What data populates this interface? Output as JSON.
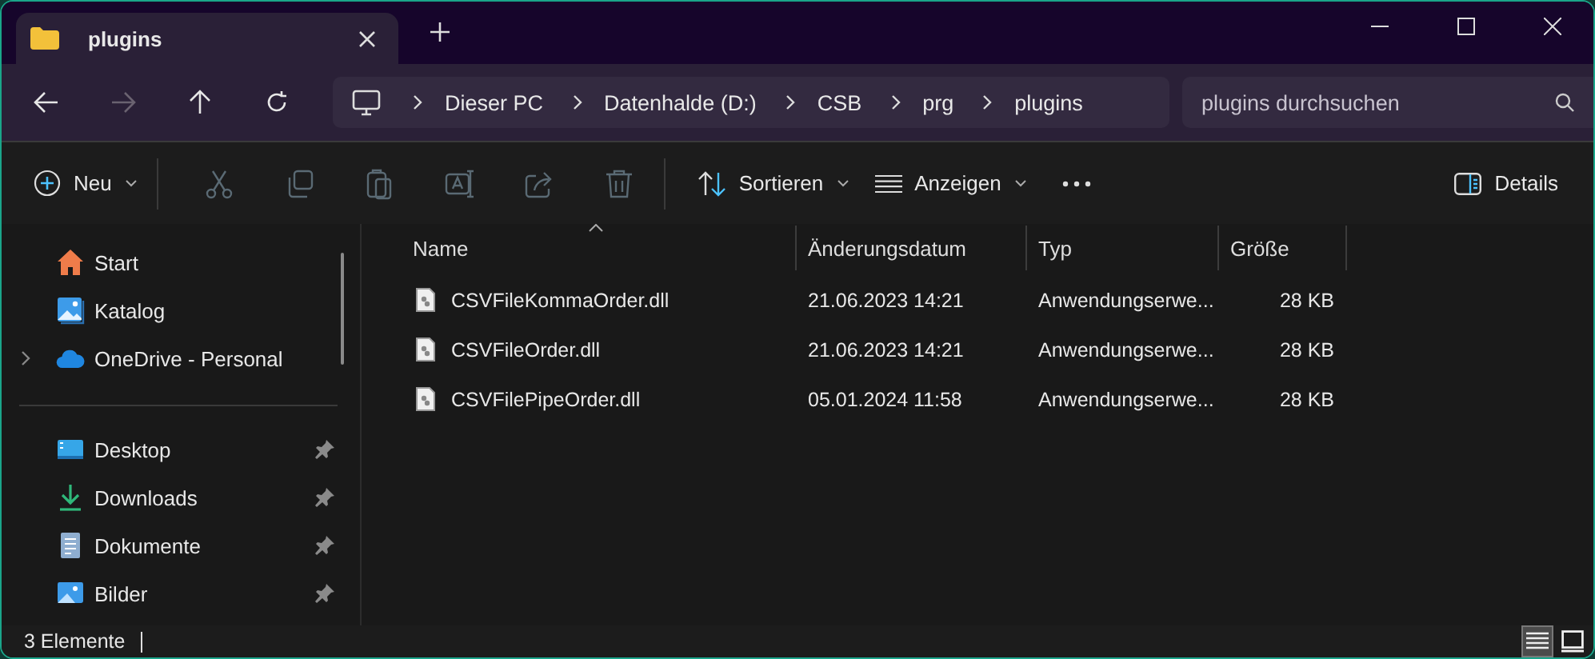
{
  "tab": {
    "title": "plugins",
    "selected": true
  },
  "window_controls": [
    {
      "kind": "minimize"
    },
    {
      "kind": "maximize"
    },
    {
      "kind": "close"
    }
  ],
  "nav_buttons": [
    {
      "kind": "back",
      "disabled": false
    },
    {
      "kind": "forward",
      "disabled": true
    },
    {
      "kind": "up",
      "disabled": false
    },
    {
      "kind": "refresh",
      "disabled": false
    }
  ],
  "breadcrumb": [
    "Dieser PC",
    "Datenhalde (D:)",
    "CSB",
    "prg",
    "plugins"
  ],
  "search": {
    "placeholder": "plugins durchsuchen"
  },
  "toolbar": {
    "new": {
      "label": "Neu"
    },
    "actions": [
      {
        "kind": "cut",
        "disabled": true
      },
      {
        "kind": "copy",
        "disabled": true
      },
      {
        "kind": "paste",
        "disabled": true
      },
      {
        "kind": "rename",
        "disabled": true
      },
      {
        "kind": "share",
        "disabled": true
      },
      {
        "kind": "delete",
        "disabled": true
      }
    ],
    "sort": {
      "label": "Sortieren"
    },
    "view": {
      "label": "Anzeigen"
    },
    "details": {
      "label": "Details"
    }
  },
  "sidebar": {
    "groups": [
      [
        {
          "kind": "home",
          "label": "Start",
          "expandable": false,
          "pinned": false
        },
        {
          "kind": "gallery",
          "label": "Katalog",
          "expandable": false,
          "pinned": false
        },
        {
          "kind": "cloud",
          "label": "OneDrive - Personal",
          "expandable": true,
          "pinned": false
        }
      ],
      [
        {
          "kind": "desktop",
          "label": "Desktop",
          "expandable": false,
          "pinned": true
        },
        {
          "kind": "download",
          "label": "Downloads",
          "expandable": false,
          "pinned": true
        },
        {
          "kind": "document",
          "label": "Dokumente",
          "expandable": false,
          "pinned": true
        },
        {
          "kind": "pictures",
          "label": "Bilder",
          "expandable": false,
          "pinned": true
        }
      ]
    ]
  },
  "table": {
    "columns": [
      {
        "label": "Name",
        "sorted": true
      },
      {
        "label": "Änderungsdatum",
        "sorted": false
      },
      {
        "label": "Typ",
        "sorted": false
      },
      {
        "label": "Größe",
        "sorted": false
      }
    ],
    "rows": [
      {
        "name": "CSVFileKommaOrder.dll",
        "date": "21.06.2023 14:21",
        "type": "Anwendungserwe...",
        "size": "28 KB",
        "selected": false
      },
      {
        "name": "CSVFileOrder.dll",
        "date": "21.06.2023 14:21",
        "type": "Anwendungserwe...",
        "size": "28 KB",
        "selected": false
      },
      {
        "name": "CSVFilePipeOrder.dll",
        "date": "05.01.2024 11:58",
        "type": "Anwendungserwe...",
        "size": "28 KB",
        "selected": false
      }
    ]
  },
  "status_bar": {
    "text": "3 Elemente",
    "views": [
      {
        "kind": "details",
        "selected": true
      },
      {
        "kind": "tiles",
        "selected": false
      }
    ]
  }
}
